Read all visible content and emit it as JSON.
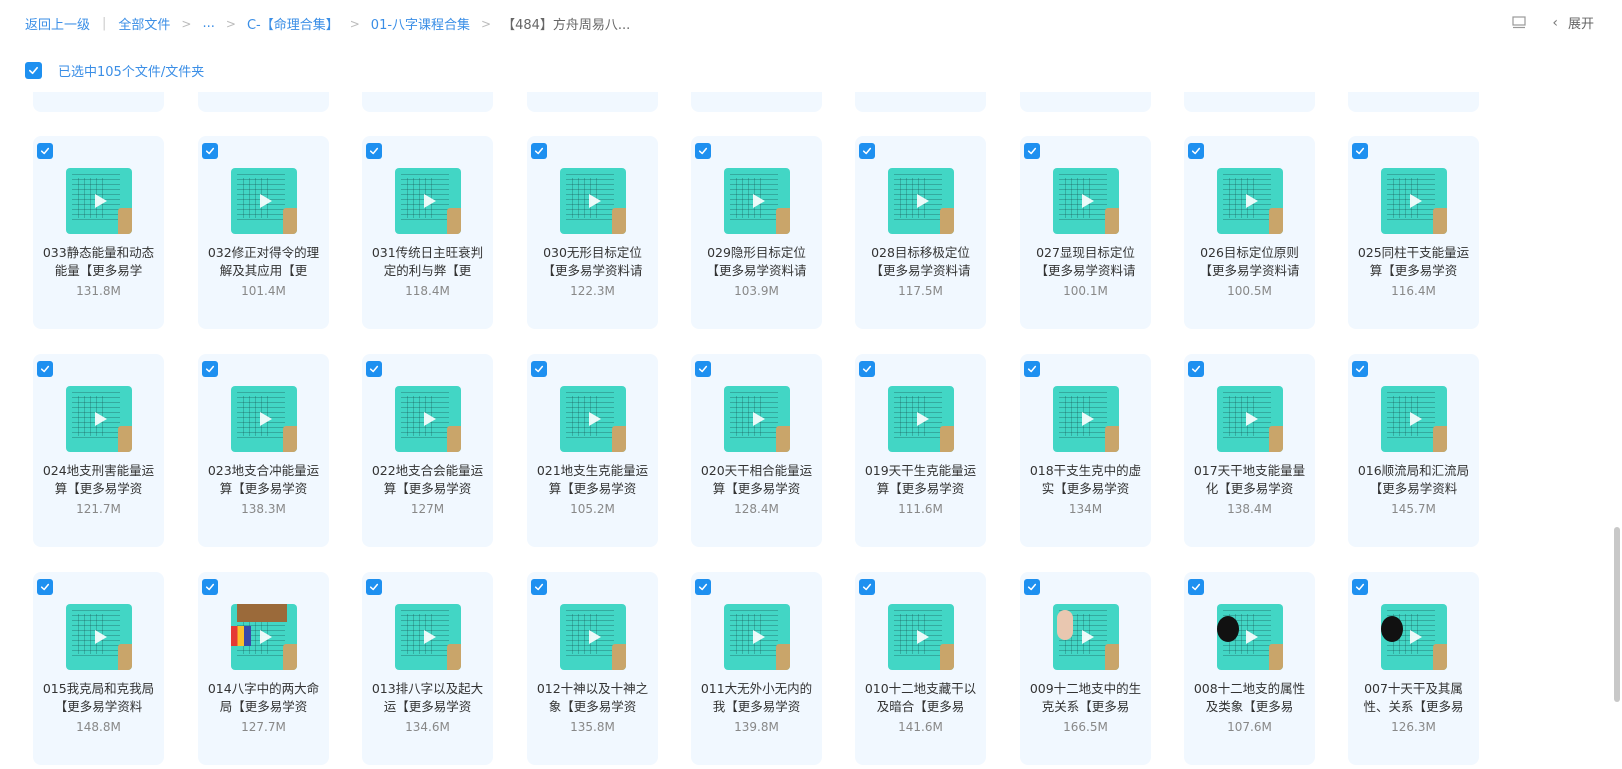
{
  "breadcrumb": {
    "back": "返回上一级",
    "all_files": "全部文件",
    "ellipsis": "...",
    "level1": "C-【命理合集】",
    "level2": "01-八字课程合集",
    "current": "【484】方舟周易八..."
  },
  "top_right": {
    "expand_label": "展开"
  },
  "selection": {
    "text": "已选中105个文件/文件夹"
  },
  "accent_color": "#1e90f0",
  "rows": [
    {
      "items": [
        {
          "title": "033静态能量和动态能量【更多易学",
          "size": "131.8M",
          "thumb": "plain"
        },
        {
          "title": "032修正对得令的理解及其应用【更",
          "size": "101.4M",
          "thumb": "plain"
        },
        {
          "title": "031传统日主旺衰判定的利与弊【更",
          "size": "118.4M",
          "thumb": "plain"
        },
        {
          "title": "030无形目标定位【更多易学资料请",
          "size": "122.3M",
          "thumb": "plain"
        },
        {
          "title": "029隐形目标定位【更多易学资料请",
          "size": "103.9M",
          "thumb": "plain"
        },
        {
          "title": "028目标移极定位【更多易学资料请",
          "size": "117.5M",
          "thumb": "plain"
        },
        {
          "title": "027显现目标定位【更多易学资料请",
          "size": "100.1M",
          "thumb": "plain"
        },
        {
          "title": "026目标定位原则【更多易学资料请",
          "size": "100.5M",
          "thumb": "plain"
        },
        {
          "title": "025同柱干支能量运算【更多易学资",
          "size": "116.4M",
          "thumb": "plain"
        }
      ]
    },
    {
      "items": [
        {
          "title": "024地支刑害能量运算【更多易学资",
          "size": "121.7M",
          "thumb": "plain"
        },
        {
          "title": "023地支合冲能量运算【更多易学资",
          "size": "138.3M",
          "thumb": "plain"
        },
        {
          "title": "022地支合会能量运算【更多易学资",
          "size": "127M",
          "thumb": "plain"
        },
        {
          "title": "021地支生克能量运算【更多易学资",
          "size": "105.2M",
          "thumb": "plain"
        },
        {
          "title": "020天干相合能量运算【更多易学资",
          "size": "128.4M",
          "thumb": "plain"
        },
        {
          "title": "019天干生克能量运算【更多易学资",
          "size": "111.6M",
          "thumb": "plain"
        },
        {
          "title": "018干支生克中的虚实【更多易学资",
          "size": "134M",
          "thumb": "plain"
        },
        {
          "title": "017天干地支能量量化【更多易学资",
          "size": "138.4M",
          "thumb": "plain"
        },
        {
          "title": "016顺流局和汇流局【更多易学资料",
          "size": "145.7M",
          "thumb": "plain"
        }
      ]
    },
    {
      "items": [
        {
          "title": "015我克局和克我局【更多易学资料",
          "size": "148.8M",
          "thumb": "plain"
        },
        {
          "title": "014八字中的两大命局【更多易学资",
          "size": "127.7M",
          "thumb": "color"
        },
        {
          "title": "013排八字以及起大运【更多易学资",
          "size": "134.6M",
          "thumb": "plain"
        },
        {
          "title": "012十神以及十神之象【更多易学资",
          "size": "135.8M",
          "thumb": "plain"
        },
        {
          "title": "011大无外小无内的我【更多易学资",
          "size": "139.8M",
          "thumb": "plain"
        },
        {
          "title": "010十二地支藏干以及暗合【更多易",
          "size": "141.6M",
          "thumb": "plain"
        },
        {
          "title": "009十二地支中的生克关系【更多易",
          "size": "166.5M",
          "thumb": "hand"
        },
        {
          "title": "008十二地支的属性及类象【更多易",
          "size": "107.6M",
          "thumb": "yinyang"
        },
        {
          "title": "007十天干及其属性、关系【更多易",
          "size": "126.3M",
          "thumb": "yinyang"
        }
      ]
    }
  ]
}
